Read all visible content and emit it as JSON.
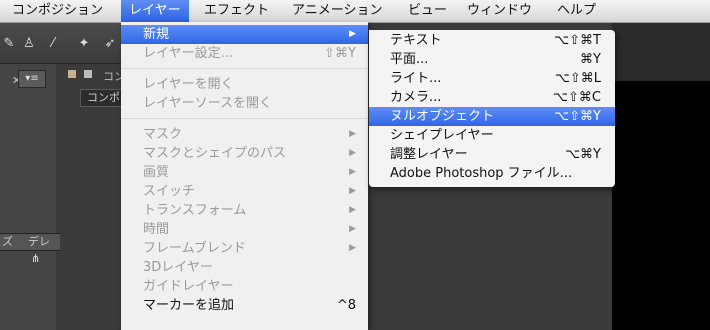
{
  "menubar": {
    "items": [
      {
        "label": "コンポジション"
      },
      {
        "label": "レイヤー"
      },
      {
        "label": "エフェクト"
      },
      {
        "label": "アニメーション"
      },
      {
        "label": "ビュー"
      },
      {
        "label": "ウィンドウ"
      },
      {
        "label": "ヘルプ"
      }
    ]
  },
  "background": {
    "tab_label": "コンポ",
    "tab_head": "コン",
    "column_headers": [
      "ズ",
      "デレ"
    ]
  },
  "layer_menu": {
    "items": [
      {
        "label": "新規",
        "shortcut": "",
        "submenu": true
      },
      {
        "label": "レイヤー設定...",
        "shortcut": "⇧⌘Y"
      },
      {
        "label": "レイヤーを開く",
        "shortcut": ""
      },
      {
        "label": "レイヤーソースを開く",
        "shortcut": ""
      },
      {
        "label": "マスク",
        "shortcut": "",
        "submenu": true
      },
      {
        "label": "マスクとシェイプのパス",
        "shortcut": "",
        "submenu": true
      },
      {
        "label": "画質",
        "shortcut": "",
        "submenu": true
      },
      {
        "label": "スイッチ",
        "shortcut": "",
        "submenu": true
      },
      {
        "label": "トランスフォーム",
        "shortcut": "",
        "submenu": true
      },
      {
        "label": "時間",
        "shortcut": "",
        "submenu": true
      },
      {
        "label": "フレームブレンド",
        "shortcut": "",
        "submenu": true
      },
      {
        "label": "3Dレイヤー",
        "shortcut": ""
      },
      {
        "label": "ガイドレイヤー",
        "shortcut": ""
      },
      {
        "label": "マーカーを追加",
        "shortcut": "^8"
      }
    ]
  },
  "new_submenu": {
    "items": [
      {
        "label": "テキスト",
        "shortcut": "⌥⇧⌘T"
      },
      {
        "label": "平面...",
        "shortcut": "⌘Y"
      },
      {
        "label": "ライト...",
        "shortcut": "⌥⇧⌘L"
      },
      {
        "label": "カメラ...",
        "shortcut": "⌥⇧⌘C"
      },
      {
        "label": "ヌルオブジェクト",
        "shortcut": "⌥⇧⌘Y"
      },
      {
        "label": "シェイプレイヤー",
        "shortcut": ""
      },
      {
        "label": "調整レイヤー",
        "shortcut": "⌥⌘Y"
      },
      {
        "label": "Adobe Photoshop ファイル...",
        "shortcut": ""
      }
    ]
  },
  "colors": {
    "highlight": "#2f66e6",
    "disabled_text": "#9a9a9a"
  }
}
